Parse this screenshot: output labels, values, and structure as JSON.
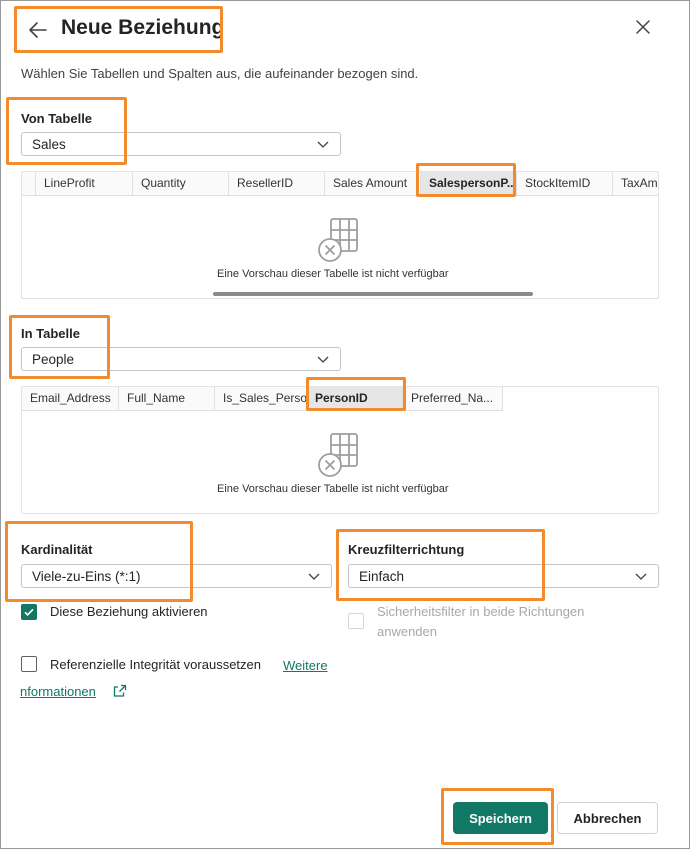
{
  "dialog": {
    "title": "Neue Beziehung",
    "subtitle": "Wählen Sie Tabellen und Spalten aus, die aufeinander bezogen sind."
  },
  "from_table": {
    "label": "Von Tabelle",
    "selected": "Sales",
    "columns": [
      "LineProfit",
      "Quantity",
      "ResellerID",
      "Sales Amount",
      "SalespersonP...",
      "StockItemID",
      "TaxAmo"
    ],
    "selected_column": "SalespersonP...",
    "empty_text": "Eine Vorschau dieser Tabelle ist nicht verfügbar"
  },
  "to_table": {
    "label": "In Tabelle",
    "selected": "People",
    "columns": [
      "Email_Address",
      "Full_Name",
      "Is_Sales_Person",
      "PersonID",
      "Preferred_Na..."
    ],
    "selected_column": "PersonID",
    "empty_text": "Eine Vorschau dieser Tabelle ist nicht verfügbar"
  },
  "cardinality": {
    "label": "Kardinalität",
    "selected": "Viele-zu-Eins (*:1)"
  },
  "cross_filter": {
    "label": "Kreuzfilterrichtung",
    "selected": "Einfach"
  },
  "options": {
    "activate": {
      "label": "Diese Beziehung aktivieren",
      "checked": true
    },
    "security_filter": {
      "label": "Sicherheitsfilter in beide Richtungen anwenden",
      "checked": false,
      "disabled": true
    },
    "referential": {
      "label": "Referenzielle Integrität voraussetzen",
      "checked": false
    },
    "more_info_part1": "Weitere",
    "more_info_part2": "nformationen"
  },
  "buttons": {
    "save": "Speichern",
    "cancel": "Abbrechen"
  },
  "icons": {
    "back": "arrow-left-icon",
    "close": "close-icon",
    "dropdown": "chevron-down-icon",
    "empty_table": "table-unavailable-icon",
    "external": "open-external-icon",
    "checkmark": "checkmark-icon"
  },
  "colors": {
    "accent": "#117865",
    "highlight": "#f28b2b",
    "selected_column_bg": "#e6e6e6"
  }
}
